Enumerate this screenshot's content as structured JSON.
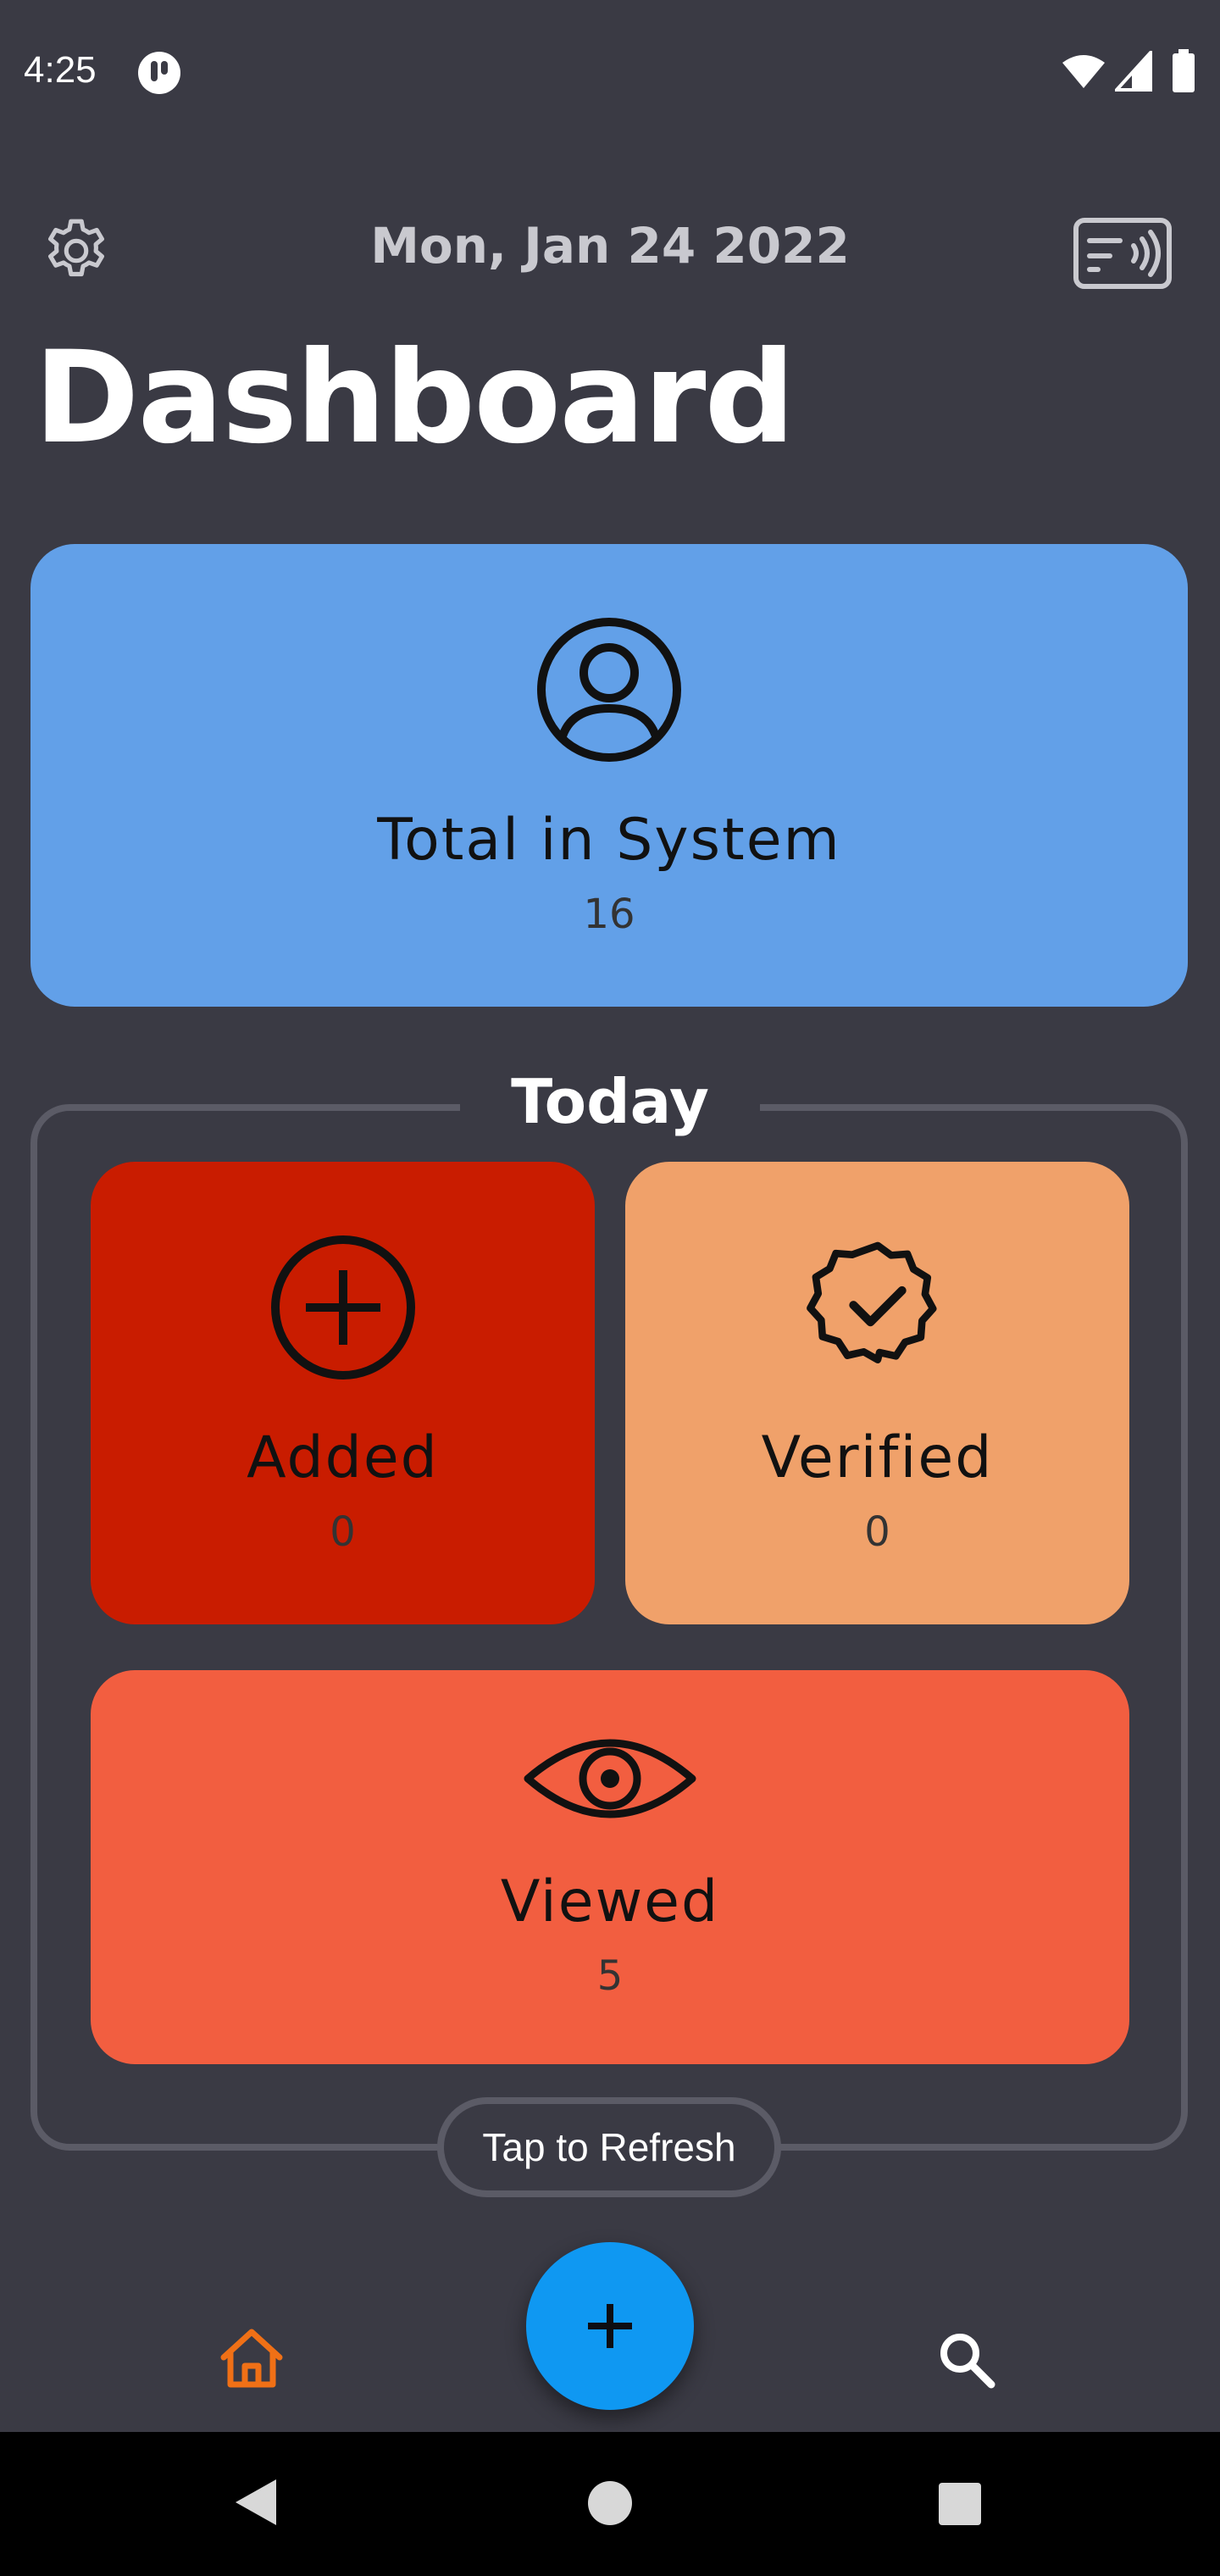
{
  "status_bar": {
    "time": "4:25"
  },
  "header": {
    "date": "Mon, Jan 24 2022",
    "title": "Dashboard"
  },
  "total_card": {
    "label": "Total in System",
    "value": "16",
    "color": "#62a0e8"
  },
  "today": {
    "title": "Today",
    "added": {
      "label": "Added",
      "value": "0",
      "color": "#c91c00"
    },
    "verified": {
      "label": "Verified",
      "value": "0",
      "color": "#f0a16a"
    },
    "viewed": {
      "label": "Viewed",
      "value": "5",
      "color": "#f25e40"
    }
  },
  "refresh_label": "Tap to Refresh",
  "bottom_nav": {
    "home_icon": "home-icon",
    "search_icon": "search-icon",
    "active_color": "#f07016",
    "fab_color": "#0f98f2"
  },
  "icons": [
    "settings-icon",
    "nfc-card-icon",
    "user-circle-icon",
    "plus-circle-icon",
    "verified-badge-icon",
    "eye-icon"
  ]
}
